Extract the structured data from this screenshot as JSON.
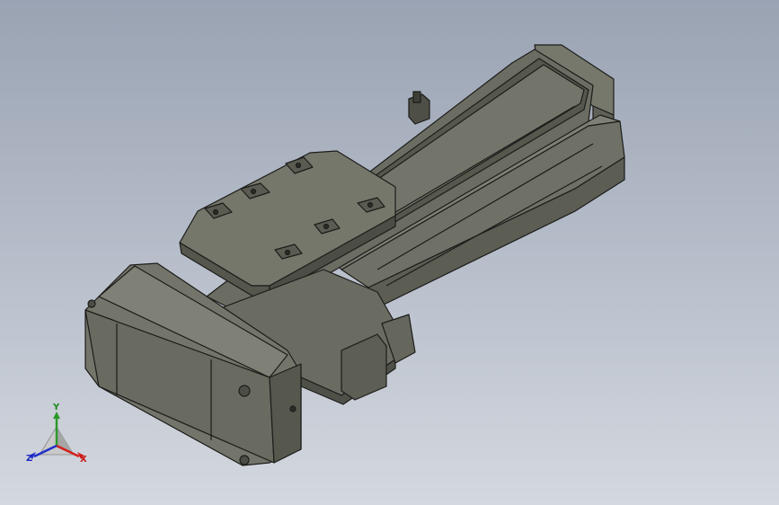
{
  "viewport": {
    "background_top": "#9aa3b3",
    "background_bottom": "#d4d8df"
  },
  "model": {
    "body_color": "#6e6f64",
    "edge_color": "#1c1c1a"
  },
  "triad": {
    "x_label": "X",
    "y_label": "Y",
    "z_label": "Z",
    "x_color": "#d22020",
    "y_color": "#2a9a2a",
    "z_color": "#2030c8"
  }
}
